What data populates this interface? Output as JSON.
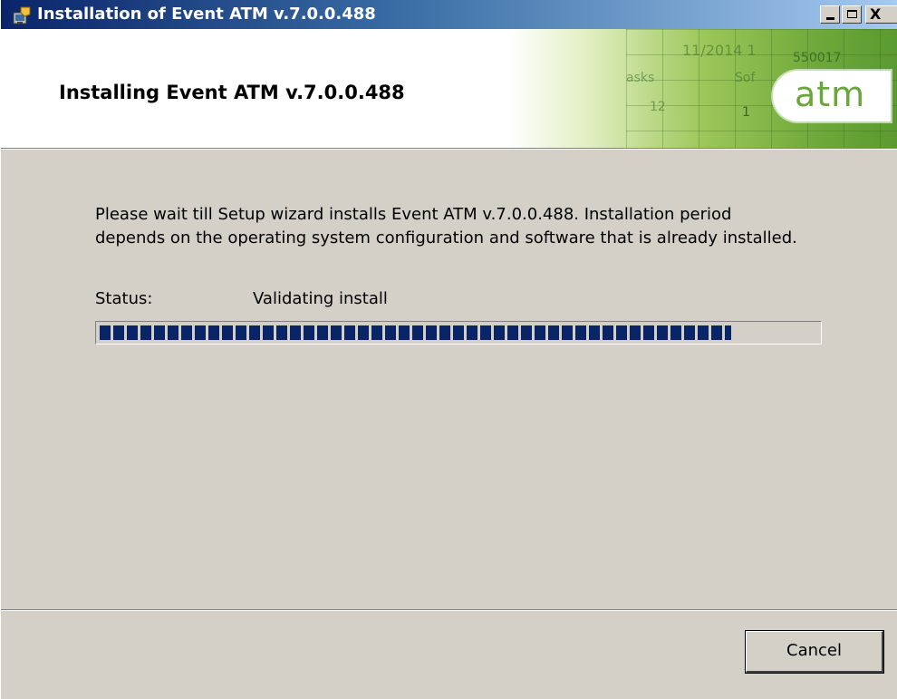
{
  "window": {
    "title": "Installation of Event ATM v.7.0.0.488",
    "controls": {
      "minimize_icon": "minimize-icon",
      "maximize_icon": "maximize-icon",
      "close_glyph": "X"
    },
    "app_icon": "installer-icon"
  },
  "header": {
    "title": "Installing Event ATM v.7.0.0.488",
    "logo_text": "atm",
    "decorative": {
      "date_fragment": "11/2014 1",
      "number_fragment": "550017",
      "tasks_fragment": "asks",
      "soft_fragment": "Sof",
      "row_fragment": "12",
      "value_fragment": "1"
    }
  },
  "body": {
    "description": "Please wait till Setup wizard installs Event ATM v.7.0.0.488. Installation period depends on the operating system configuration and software that is already installed.",
    "status_label": "Status:",
    "status_value": "Validating install",
    "progress_fraction": 0.88
  },
  "footer": {
    "cancel_label": "Cancel"
  },
  "colors": {
    "titlebar_start": "#0a246a",
    "progress": "#0a246a",
    "brand_green": "#6aa63a",
    "dialog_bg": "#d4d0c8"
  }
}
